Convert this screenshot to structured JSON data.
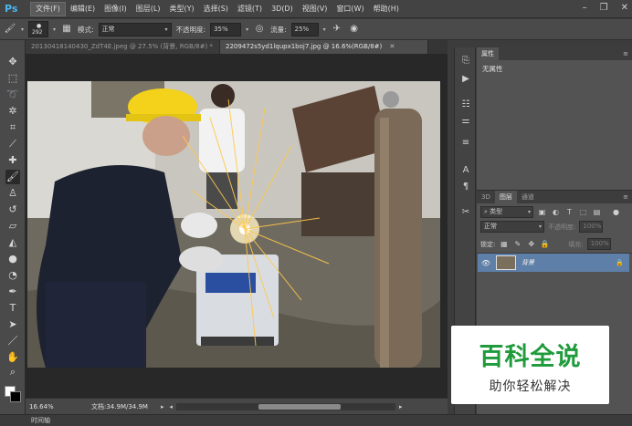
{
  "app": {
    "logo": "Ps"
  },
  "menu": [
    "文件(F)",
    "编辑(E)",
    "图像(I)",
    "图层(L)",
    "类型(Y)",
    "选择(S)",
    "滤镜(T)",
    "3D(D)",
    "视图(V)",
    "窗口(W)",
    "帮助(H)"
  ],
  "options": {
    "brush_size": "292",
    "mode_label": "模式:",
    "mode_value": "正常",
    "opacity_label": "不透明度:",
    "opacity_value": "35%",
    "flow_label": "流量:",
    "flow_value": "25%"
  },
  "tabs": [
    {
      "label": "20130418140430_ZdT4E.jpeg @ 27.5% (背景, RGB/8#) *",
      "active": false
    },
    {
      "label": "2209472s5yd1lqupx1boj7.jpg @ 16.6%(RGB/8#)",
      "active": true
    }
  ],
  "status": {
    "zoom": "16.64%",
    "doc_info": "文档:34.9M/34.9M"
  },
  "timeline_label": "时间轴",
  "properties": {
    "tab": "属性",
    "content": "无属性"
  },
  "layers": {
    "tabs": [
      "3D",
      "图层",
      "通道"
    ],
    "filter_kind": "类型",
    "blend_mode": "正常",
    "opacity_label": "不透明度:",
    "opacity_value": "100%",
    "lock_label": "锁定:",
    "fill_label": "填充:",
    "fill_value": "100%",
    "items": [
      {
        "name": "背景"
      }
    ]
  },
  "watermark": {
    "title": "百科全说",
    "subtitle": "助你轻松解决"
  }
}
